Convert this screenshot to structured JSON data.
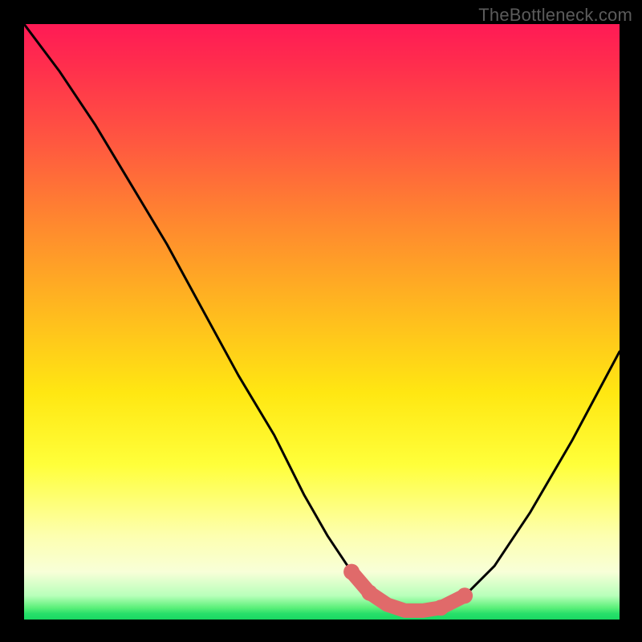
{
  "attribution": "TheBottleneck.com",
  "chart_data": {
    "type": "line",
    "title": "",
    "xlabel": "",
    "ylabel": "",
    "xlim": [
      0,
      100
    ],
    "ylim": [
      0,
      100
    ],
    "x": [
      0,
      6,
      12,
      18,
      24,
      30,
      36,
      42,
      47,
      51,
      55,
      58,
      61,
      64,
      67,
      70,
      74,
      79,
      85,
      92,
      100
    ],
    "values": [
      100,
      92,
      83,
      73,
      63,
      52,
      41,
      31,
      21,
      14,
      8,
      4.5,
      2.5,
      1.5,
      1.5,
      2,
      4,
      9,
      18,
      30,
      45
    ],
    "gradient_stops": [
      {
        "pos": 0,
        "color": "#ff1a55"
      },
      {
        "pos": 20,
        "color": "#ff5840"
      },
      {
        "pos": 48,
        "color": "#ffb91f"
      },
      {
        "pos": 74,
        "color": "#ffff3a"
      },
      {
        "pos": 92,
        "color": "#f8ffd8"
      },
      {
        "pos": 98,
        "color": "#5cf07a"
      },
      {
        "pos": 100,
        "color": "#19d862"
      }
    ],
    "highlight": {
      "color": "#e06a6a",
      "points_x": [
        55,
        58,
        61,
        64,
        67,
        70,
        74
      ],
      "points_y": [
        8,
        4.5,
        2.5,
        1.5,
        1.5,
        2,
        4
      ]
    }
  }
}
